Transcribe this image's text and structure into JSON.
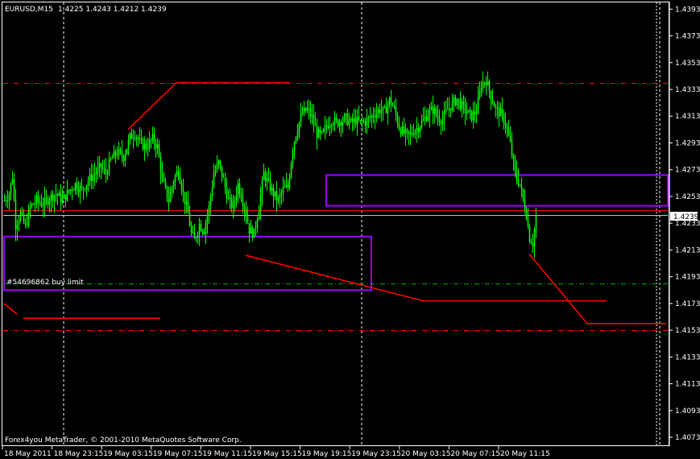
{
  "header": {
    "title": "EURUSD,M15",
    "ohlc": "1.4225 1.4243 1.4212 1.4239"
  },
  "footer": {
    "copyright": "Forex4you MetaTrader, © 2001-2010 MetaQuotes Software Corp."
  },
  "order_label": "#54696862 buy limit",
  "current_price_label": "1.4239",
  "colors": {
    "background": "#000000",
    "frame": "#ffffff",
    "candle": "#00ff00",
    "trendline": "#ff0000",
    "level": "#ff0000",
    "zone": "#9900ff",
    "order": "#00aa00",
    "bid": "#c0c0c0"
  },
  "chart_data": {
    "type": "candlestick",
    "symbol": "EURUSD",
    "timeframe": "M15",
    "ylim": [
      1.4067,
      1.4398
    ],
    "y_ticks": [
      "1.4393",
      "1.4373",
      "1.4353",
      "1.4333",
      "1.4313",
      "1.4293",
      "1.4273",
      "1.4253",
      "1.4233",
      "1.4213",
      "1.4193",
      "1.4173",
      "1.4153",
      "1.4133",
      "1.4113",
      "1.4093",
      "1.4073"
    ],
    "x_ticks": [
      "18 May 2011",
      "18 May 23:15",
      "19 May 03:15",
      "19 May 07:15",
      "19 May 11:15",
      "19 May 15:15",
      "19 May 19:15",
      "19 May 23:15",
      "20 May 03:15",
      "20 May 07:15",
      "20 May 11:15"
    ],
    "close_path": [
      [
        0,
        1.425
      ],
      [
        3,
        1.4255
      ],
      [
        5,
        1.4268
      ],
      [
        7,
        1.4232
      ],
      [
        10,
        1.424
      ],
      [
        13,
        1.423
      ],
      [
        16,
        1.4245
      ],
      [
        20,
        1.425
      ],
      [
        24,
        1.4247
      ],
      [
        28,
        1.4252
      ],
      [
        32,
        1.4255
      ],
      [
        36,
        1.425
      ],
      [
        40,
        1.4257
      ],
      [
        44,
        1.4262
      ],
      [
        48,
        1.4258
      ],
      [
        52,
        1.4265
      ],
      [
        56,
        1.427
      ],
      [
        60,
        1.4275
      ],
      [
        63,
        1.427
      ],
      [
        66,
        1.428
      ],
      [
        70,
        1.4286
      ],
      [
        74,
        1.4283
      ],
      [
        78,
        1.4297
      ],
      [
        81,
        1.4301
      ],
      [
        84,
        1.4293
      ],
      [
        88,
        1.429
      ],
      [
        92,
        1.4296
      ],
      [
        95,
        1.429
      ],
      [
        98,
        1.4265
      ],
      [
        102,
        1.425
      ],
      [
        105,
        1.4265
      ],
      [
        108,
        1.4273
      ],
      [
        111,
        1.4255
      ],
      [
        114,
        1.424
      ],
      [
        116,
        1.4225
      ],
      [
        118,
        1.422
      ],
      [
        121,
        1.4232
      ],
      [
        124,
        1.4228
      ],
      [
        127,
        1.4245
      ],
      [
        130,
        1.427
      ],
      [
        133,
        1.4278
      ],
      [
        136,
        1.4265
      ],
      [
        139,
        1.425
      ],
      [
        142,
        1.4245
      ],
      [
        145,
        1.4262
      ],
      [
        148,
        1.425
      ],
      [
        150,
        1.424
      ],
      [
        152,
        1.4228
      ],
      [
        155,
        1.4225
      ],
      [
        158,
        1.4245
      ],
      [
        161,
        1.427
      ],
      [
        164,
        1.4262
      ],
      [
        167,
        1.4255
      ],
      [
        170,
        1.425
      ],
      [
        173,
        1.4258
      ],
      [
        176,
        1.426
      ],
      [
        179,
        1.429
      ],
      [
        182,
        1.4305
      ],
      [
        185,
        1.4315
      ],
      [
        188,
        1.4318
      ],
      [
        191,
        1.4312
      ],
      [
        194,
        1.43
      ],
      [
        197,
        1.4298
      ],
      [
        200,
        1.4306
      ],
      [
        203,
        1.431
      ],
      [
        206,
        1.4308
      ],
      [
        209,
        1.431
      ],
      [
        212,
        1.4311
      ],
      [
        215,
        1.4308
      ],
      [
        218,
        1.431
      ],
      [
        221,
        1.4308
      ],
      [
        224,
        1.4309
      ],
      [
        227,
        1.4312
      ],
      [
        230,
        1.4315
      ],
      [
        233,
        1.4318
      ],
      [
        236,
        1.4316
      ],
      [
        239,
        1.4325
      ],
      [
        242,
        1.4318
      ],
      [
        245,
        1.4305
      ],
      [
        248,
        1.43
      ],
      [
        251,
        1.4298
      ],
      [
        254,
        1.4302
      ],
      [
        257,
        1.4305
      ],
      [
        260,
        1.431
      ],
      [
        263,
        1.4315
      ],
      [
        266,
        1.4318
      ],
      [
        269,
        1.4312
      ],
      [
        272,
        1.431
      ],
      [
        275,
        1.4318
      ],
      [
        278,
        1.4322
      ],
      [
        281,
        1.4326
      ],
      [
        284,
        1.432
      ],
      [
        287,
        1.4316
      ],
      [
        290,
        1.4313
      ],
      [
        293,
        1.4317
      ],
      [
        296,
        1.4337
      ],
      [
        299,
        1.434
      ],
      [
        302,
        1.4328
      ],
      [
        305,
        1.4318
      ],
      [
        308,
        1.4315
      ],
      [
        311,
        1.4308
      ],
      [
        314,
        1.4292
      ],
      [
        317,
        1.427
      ],
      [
        320,
        1.4262
      ],
      [
        322,
        1.425
      ],
      [
        324,
        1.424
      ],
      [
        326,
        1.4222
      ],
      [
        328,
        1.4218
      ],
      [
        330,
        1.4239
      ]
    ],
    "n_bars": 331,
    "levels": [
      {
        "price": 1.4338,
        "style": "dashdot",
        "color": "#ff0000",
        "name": "resistance"
      },
      {
        "price": 1.4243,
        "style": "solid",
        "color": "#ff0000",
        "name": "ask-line"
      },
      {
        "price": 1.4239,
        "style": "solid",
        "color": "#c0c0c0",
        "name": "bid-line"
      },
      {
        "price": 1.4188,
        "style": "dashdot",
        "color": "#00aa00",
        "name": "buy-limit"
      },
      {
        "price": 1.4153,
        "style": "dashdot",
        "color": "#ff0000",
        "name": "support"
      }
    ],
    "zones": [
      {
        "bar_from": 0,
        "bar_to": 228,
        "price_top": 1.4223,
        "price_bottom": 1.4183
      },
      {
        "bar_from": 200,
        "bar_to": 415,
        "price_top": 1.4269,
        "price_bottom": 1.4246
      }
    ],
    "trendlines": [
      [
        [
          77,
          1.4303
        ],
        [
          107,
          1.4338
        ],
        [
          177,
          1.4338
        ]
      ],
      [
        [
          0,
          1.4173
        ],
        [
          8,
          1.4165
        ]
      ],
      [
        [
          12,
          1.4162
        ],
        [
          97,
          1.4162
        ]
      ],
      [
        [
          150,
          1.4209
        ],
        [
          260,
          1.4175
        ],
        [
          374,
          1.4175
        ]
      ],
      [
        [
          326,
          1.421
        ],
        [
          362,
          1.4158
        ],
        [
          411,
          1.4158
        ]
      ]
    ],
    "vgrid_bars": [
      37,
      222,
      407
    ]
  }
}
